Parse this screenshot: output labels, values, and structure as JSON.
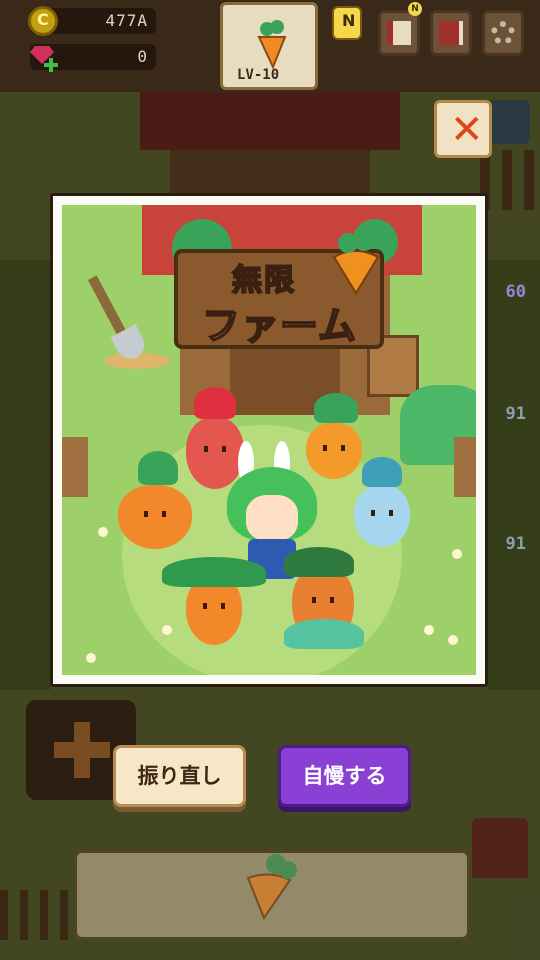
{
  "hud": {
    "coins": "477A",
    "gems": "0",
    "level_label": "LV-10",
    "notification_badge": "N",
    "book_badge": "N"
  },
  "modal": {
    "close_label": "✕",
    "image": {
      "logo_line1": "無限",
      "logo_line2": "ファーム"
    },
    "retry_label": "振り直し",
    "brag_label": "自慢する"
  },
  "background": {
    "side_values": [
      "60",
      "91",
      "91"
    ]
  },
  "icons": {
    "coin": "coin-icon",
    "gem": "gem-icon",
    "carrot": "carrot-icon",
    "journal": "journal-icon",
    "codex": "codex-icon",
    "settings": "gear-icon",
    "camera": "camera-icon",
    "close": "close-icon"
  },
  "colors": {
    "close": "#e0441e",
    "brag_button": "#8a40d4",
    "retry_button": "#f7e7c6",
    "art_grass": "#9ed06a"
  }
}
